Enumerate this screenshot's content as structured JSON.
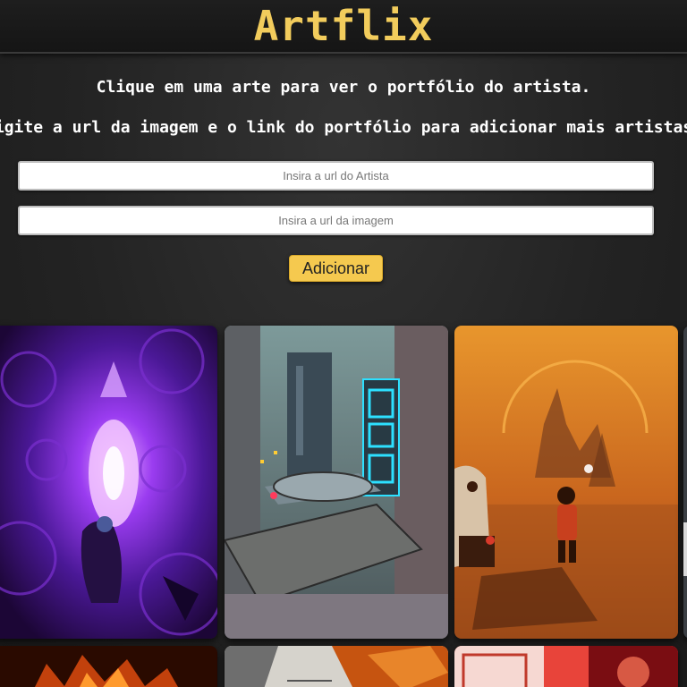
{
  "header": {
    "logo": "Artflix"
  },
  "instructions": {
    "line1": "Clique em uma arte para ver o portfólio do artista.",
    "line2": "Digite a url da imagem e o link do portfólio para adicionar mais artistas."
  },
  "form": {
    "artist_placeholder": "Insira a url do Artista",
    "image_placeholder": "Insira a url da imagem",
    "add_label": "Adicionar"
  },
  "gallery": {
    "cards": [
      {
        "name": "artwork-purple-cavern",
        "colors": [
          "#2a0f4d",
          "#6a22c2",
          "#c35cff"
        ]
      },
      {
        "name": "artwork-cyber-city",
        "colors": [
          "#3b4a4e",
          "#5e7a7c",
          "#2de0ff"
        ]
      },
      {
        "name": "artwork-orange-ruins",
        "colors": [
          "#b4561c",
          "#e0922e",
          "#f3b454"
        ]
      },
      {
        "name": "artwork-fire-scene",
        "colors": [
          "#2a0a00",
          "#c2410c",
          "#ff9a2e"
        ]
      },
      {
        "name": "artwork-autumn-forest",
        "colors": [
          "#ffffff",
          "#8a8a8a",
          "#d35400"
        ]
      },
      {
        "name": "artwork-red-neon",
        "colors": [
          "#7a0d12",
          "#e8443a",
          "#ffd1c8"
        ]
      }
    ]
  },
  "colors": {
    "accent": "#f2cc5c",
    "button": "#f5c94f",
    "background": "#262626"
  }
}
